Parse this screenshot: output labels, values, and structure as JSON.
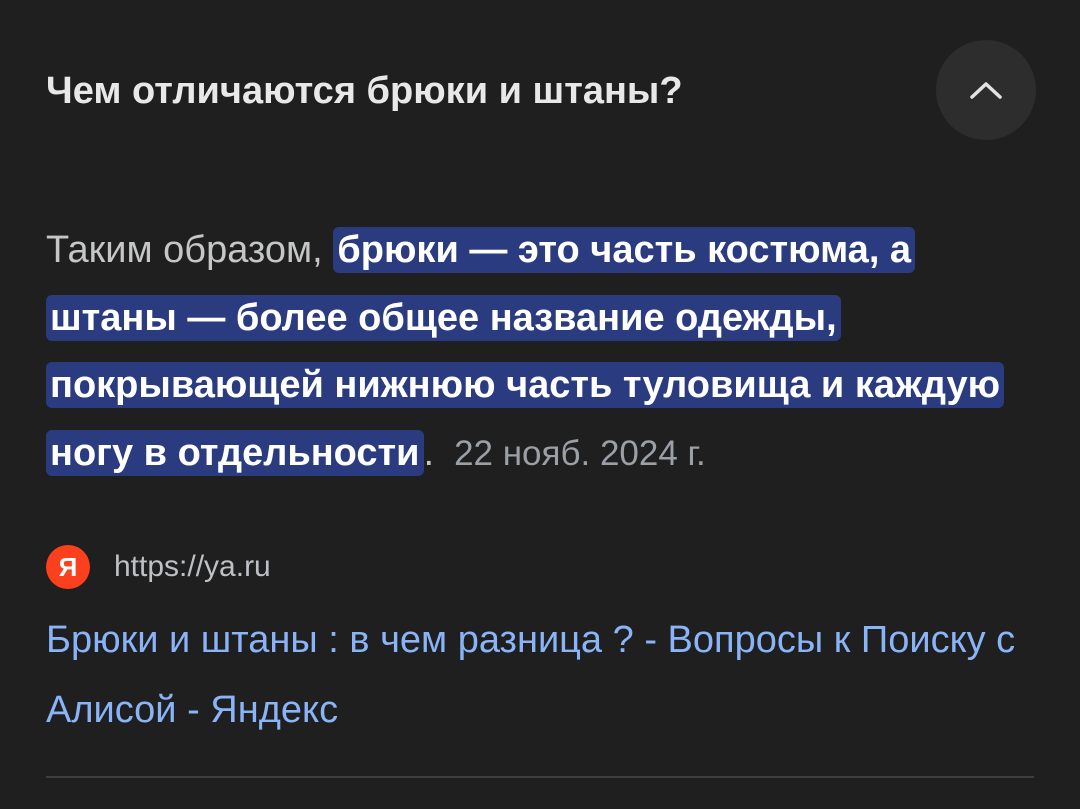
{
  "question": {
    "title": "Чем отличаются брюки и штаны?",
    "collapse_icon": "chevron-up-icon"
  },
  "answer": {
    "lead": "Таким образом,",
    "highlight": "брюки — это часть костюма, а штаны — более общее название одежды, покрывающей нижнюю часть туловища и каждую ногу в отдельности",
    "trailing": ".",
    "date": "22 нояб. 2024 г.",
    "highlight_color": "#2b3b80"
  },
  "source": {
    "favicon_letter": "Я",
    "favicon_color": "#fc3f1d",
    "url": "https://ya.ru"
  },
  "result": {
    "title": "Брюки и штаны : в чем разница ? - Вопросы к Поиску с Алисой - Яндекс",
    "link_color": "#8ab4f8"
  }
}
